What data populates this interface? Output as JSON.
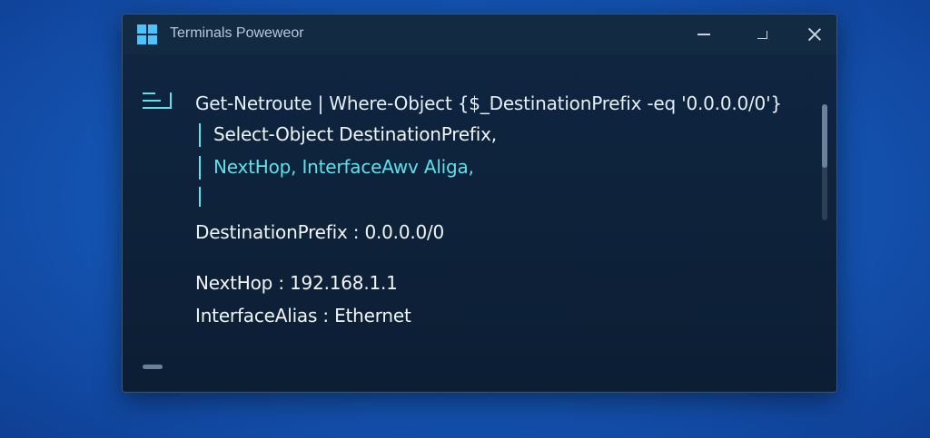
{
  "window": {
    "title": "Terminals Poweweor",
    "icon": "windows-logo-icon"
  },
  "controls": {
    "minimize": "minimize-icon",
    "maximize": "maximize-icon",
    "close": "close-icon"
  },
  "terminal": {
    "command_line_1": "Get-Netroute | Where-Object {$_DestinationPrefix -eq '0.0.0.0/0'}",
    "command_line_2": "Select-Object DestinationPrefix,",
    "command_line_3": "NextHop, InterfaceAwv  Aliga,",
    "output_destination": "DestinationPrefix : 0.0.0.0/0",
    "output_nexthop": "NextHop : 192.168.1.1",
    "output_interface": "InterfaceAlias : Ethernet"
  },
  "colors": {
    "accent_cyan": "#5fe0ea",
    "window_bg": "#0e2238",
    "desktop_blue": "#1558b8"
  }
}
